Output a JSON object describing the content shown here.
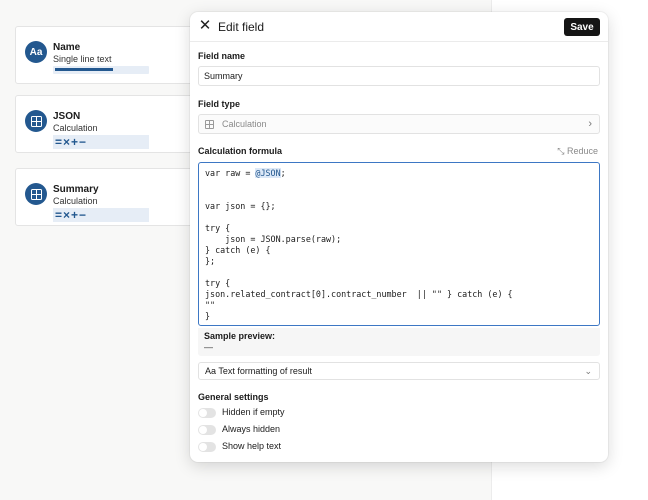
{
  "fields": [
    {
      "name": "Name",
      "type": "Single line text",
      "icon": "text-aa-icon",
      "icon_text": "Aa",
      "preview": "bar",
      "bar_fill": 0.6
    },
    {
      "name": "JSON",
      "type": "Calculation",
      "icon": "calculation-icon",
      "icon_text": "",
      "preview": "ops",
      "ops": "=×+−"
    },
    {
      "name": "Summary",
      "type": "Calculation",
      "icon": "calculation-icon",
      "icon_text": "",
      "preview": "ops",
      "ops": "=×+−"
    }
  ],
  "modal": {
    "title": "Edit field",
    "save_label": "Save",
    "field_name_label": "Field name",
    "field_name_value": "Summary",
    "field_type_label": "Field type",
    "field_type_value": "Calculation",
    "formula_label": "Calculation formula",
    "reduce_label": "Reduce",
    "formula_lines": [
      "var raw = @JSON;",
      "",
      "",
      "var json = {};",
      "",
      "try {",
      "    json = JSON.parse(raw);",
      "} catch (e) {",
      "};",
      "",
      "try {",
      "json.related_contract[0].contract_number  || \"\" } catch (e) {",
      "\"\"",
      "}"
    ],
    "highlight_token": "@JSON",
    "sample_label": "Sample preview:",
    "sample_value": "—",
    "format_label": "Aa Text formatting of result",
    "general_label": "General settings",
    "toggles": [
      "Hidden if empty",
      "Always hidden",
      "Show help text"
    ]
  },
  "colors": {
    "accent": "#23588f",
    "focus_border": "#3d77c4",
    "save_bg": "#151515"
  }
}
